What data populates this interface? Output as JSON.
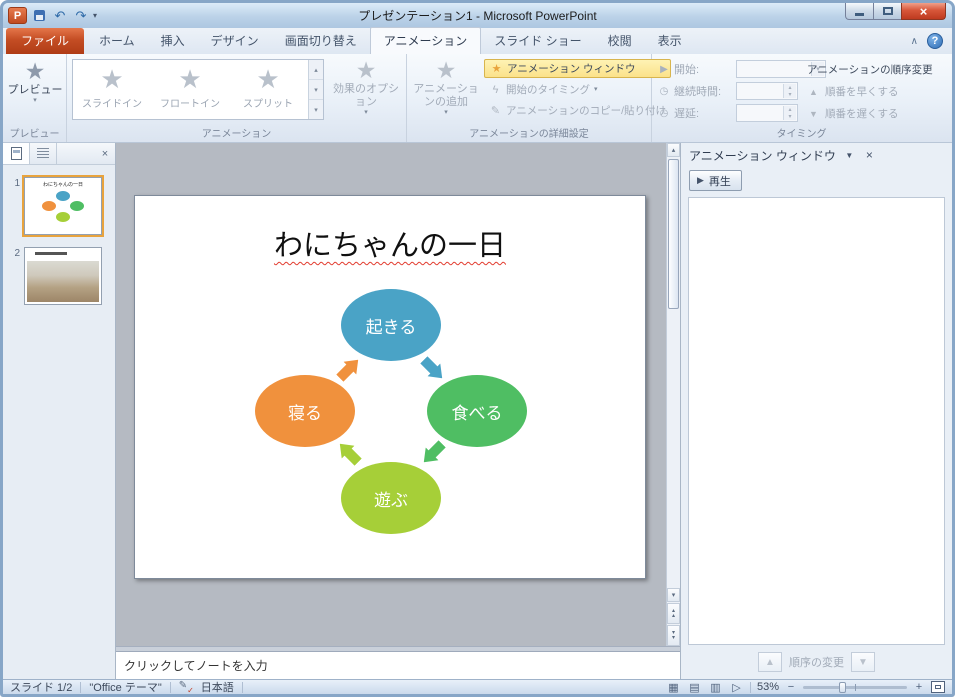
{
  "icons": {
    "app": "P",
    "undo": "↶",
    "redo": "↷",
    "dropdown": "▾",
    "help": "?",
    "collapse_ribbon": "∧",
    "star": "★",
    "play": "▶",
    "up": "▲",
    "down": "▼",
    "small_up": "▴",
    "small_down": "▾",
    "close": "×",
    "pencil": "✎",
    "check": "✓",
    "clock": "◷",
    "lightning": "ϟ",
    "minus": "−",
    "plus": "+",
    "view_normal": "▦",
    "view_sorter": "▤",
    "view_reading": "▥",
    "view_slideshow": "▷"
  },
  "window": {
    "title": "プレゼンテーション1 - Microsoft PowerPoint"
  },
  "tabs": {
    "file": "ファイル",
    "items": [
      "ホーム",
      "挿入",
      "デザイン",
      "画面切り替え",
      "アニメーション",
      "スライド ショー",
      "校閲",
      "表示"
    ]
  },
  "ribbon": {
    "preview": {
      "button": "プレビュー",
      "group": "プレビュー"
    },
    "animation": {
      "items": [
        "スライドイン",
        "フロートイン",
        "スプリット"
      ],
      "effect_options": "効果のオプション",
      "group": "アニメーション"
    },
    "advanced": {
      "add_animation": "アニメーションの追加",
      "animation_pane": "アニメーション ウィンドウ",
      "trigger": "開始のタイミング",
      "painter": "アニメーションのコピー/貼り付け",
      "group": "アニメーションの詳細設定"
    },
    "timing": {
      "start": "開始:",
      "duration": "継続時間:",
      "delay": "遅延:",
      "group": "タイミング",
      "reorder_title": "アニメーションの順序変更",
      "earlier": "順番を早くする",
      "later": "順番を遅くする"
    }
  },
  "slides_panel": {
    "slide1_number": "1",
    "slide2_number": "2"
  },
  "slide": {
    "title": "わにちゃんの一日",
    "shapes": [
      {
        "label": "起きる",
        "color": "#4AA3C6"
      },
      {
        "label": "食べる",
        "color": "#4FBE63"
      },
      {
        "label": "遊ぶ",
        "color": "#A6CF38"
      },
      {
        "label": "寝る",
        "color": "#F0913D"
      }
    ]
  },
  "notes": {
    "placeholder": "クリックしてノートを入力"
  },
  "animation_pane": {
    "title": "アニメーション ウィンドウ",
    "play": "再生",
    "reorder": "順序の変更"
  },
  "status": {
    "slide": "スライド 1/2",
    "theme": "\"Office テーマ\"",
    "language": "日本語",
    "zoom": "53%"
  }
}
